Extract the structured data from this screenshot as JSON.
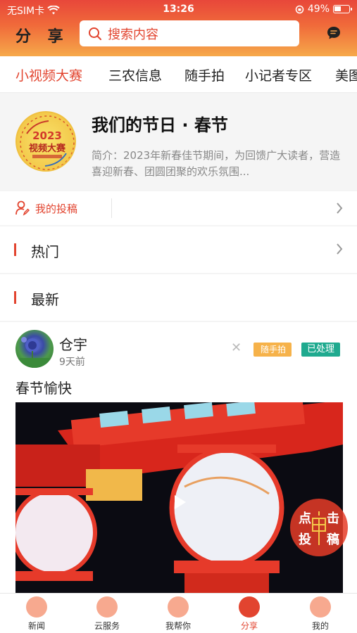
{
  "status_bar": {
    "carrier": "无SIM卡",
    "time": "13:26",
    "battery": "49%",
    "battery_level": 0.49
  },
  "header": {
    "title": "分 享",
    "search_placeholder": "搜索内容"
  },
  "tabs": [
    {
      "label": "小视频大赛",
      "active": true
    },
    {
      "label": "三农信息",
      "active": false
    },
    {
      "label": "随手拍",
      "active": false
    },
    {
      "label": "小记者专区",
      "active": false
    },
    {
      "label": "美图",
      "active": false
    }
  ],
  "topic": {
    "logo_text_1": "2023",
    "logo_text_2": "视频大赛",
    "title": "我们的节日 · 春节",
    "description": "简介：2023年新春佳节期间，为回馈广大读者，营造喜迎新春、团圆团聚的欢乐氛围..."
  },
  "my_submissions": "我的投稿",
  "sections": {
    "hot": "热门",
    "latest": "最新"
  },
  "post": {
    "author": "仓宇",
    "time": "9天前",
    "category_tag": "随手拍",
    "status_tag": "已处理",
    "text": "春节愉快"
  },
  "fab": {
    "c1": "点",
    "c2": "击",
    "c3": "投",
    "c4": "稿"
  },
  "bottom_tabs": [
    {
      "label": "新闻",
      "active": false
    },
    {
      "label": "云服务",
      "active": false
    },
    {
      "label": "我帮你",
      "active": false
    },
    {
      "label": "分享",
      "active": true
    },
    {
      "label": "我的",
      "active": false
    }
  ],
  "colors": {
    "accent": "#e2442f",
    "teal": "#1faa8f",
    "orange_tag": "#f6b24a"
  }
}
